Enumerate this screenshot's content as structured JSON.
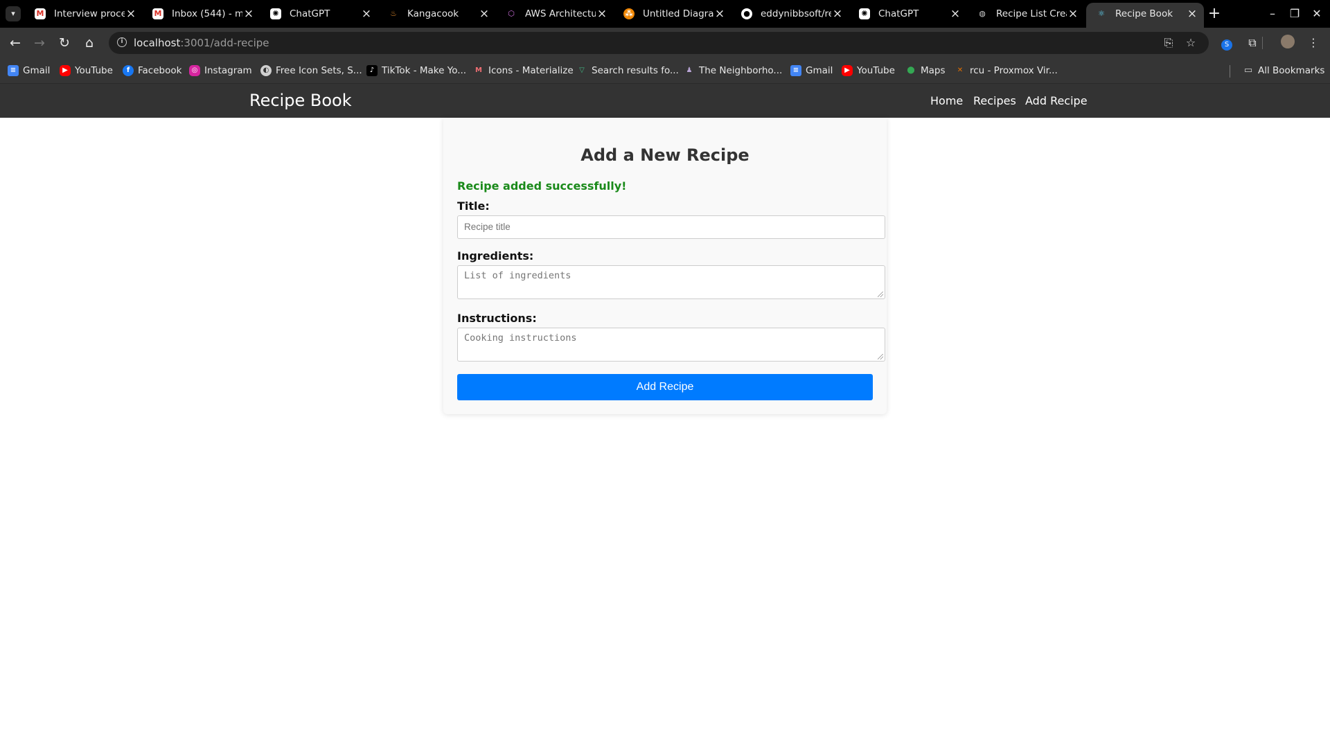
{
  "browser": {
    "tabs": [
      {
        "title": "Interview proce",
        "icon": "gmail-icon",
        "active": false
      },
      {
        "title": "Inbox (544) - m",
        "icon": "gmail-icon",
        "active": false
      },
      {
        "title": "ChatGPT",
        "icon": "chatgpt-icon",
        "active": false
      },
      {
        "title": "Kangacook",
        "icon": "kangacook-icon",
        "active": false
      },
      {
        "title": "AWS Architectur",
        "icon": "aws-icon",
        "active": false
      },
      {
        "title": "Untitled Diagran",
        "icon": "drawio-icon",
        "active": false
      },
      {
        "title": "eddynibbsoft/re",
        "icon": "github-icon",
        "active": false
      },
      {
        "title": "ChatGPT",
        "icon": "chatgpt-icon",
        "active": false
      },
      {
        "title": "Recipe List Crea",
        "icon": "globe-icon",
        "active": false
      },
      {
        "title": "Recipe Book",
        "icon": "react-icon",
        "active": true
      }
    ],
    "url_host": "localhost",
    "url_rest": ":3001/add-recipe",
    "bookmarks": [
      {
        "label": "Gmail",
        "icon": "google-docs-icon"
      },
      {
        "label": "YouTube",
        "icon": "youtube-icon"
      },
      {
        "label": "Facebook",
        "icon": "facebook-icon"
      },
      {
        "label": "Instagram",
        "icon": "instagram-icon"
      },
      {
        "label": "Free Icon Sets, S...",
        "icon": "icon-sets-icon"
      },
      {
        "label": "TikTok - Make Yo...",
        "icon": "tiktok-icon"
      },
      {
        "label": "Icons - Materialize",
        "icon": "materialize-icon"
      },
      {
        "label": "Search results fo...",
        "icon": "vuetify-icon"
      },
      {
        "label": "The Neighborho...",
        "icon": "neighborhood-icon"
      },
      {
        "label": "Gmail",
        "icon": "google-docs-icon"
      },
      {
        "label": "YouTube",
        "icon": "youtube-icon"
      },
      {
        "label": "Maps",
        "icon": "maps-icon"
      },
      {
        "label": "rcu - Proxmox Vir...",
        "icon": "proxmox-icon"
      }
    ],
    "all_bookmarks": "All Bookmarks"
  },
  "app": {
    "brand": "Recipe Book",
    "nav": [
      "Home",
      "Recipes",
      "Add Recipe"
    ]
  },
  "form": {
    "heading": "Add a New Recipe",
    "success_message": "Recipe added successfully!",
    "title_label": "Title:",
    "title_placeholder": "Recipe title",
    "ingredients_label": "Ingredients:",
    "ingredients_placeholder": "List of ingredients",
    "instructions_label": "Instructions:",
    "instructions_placeholder": "Cooking instructions",
    "submit_label": "Add Recipe"
  },
  "colors": {
    "navbar": "#333333",
    "submit": "#007bff",
    "success": "#1a8a1a"
  }
}
